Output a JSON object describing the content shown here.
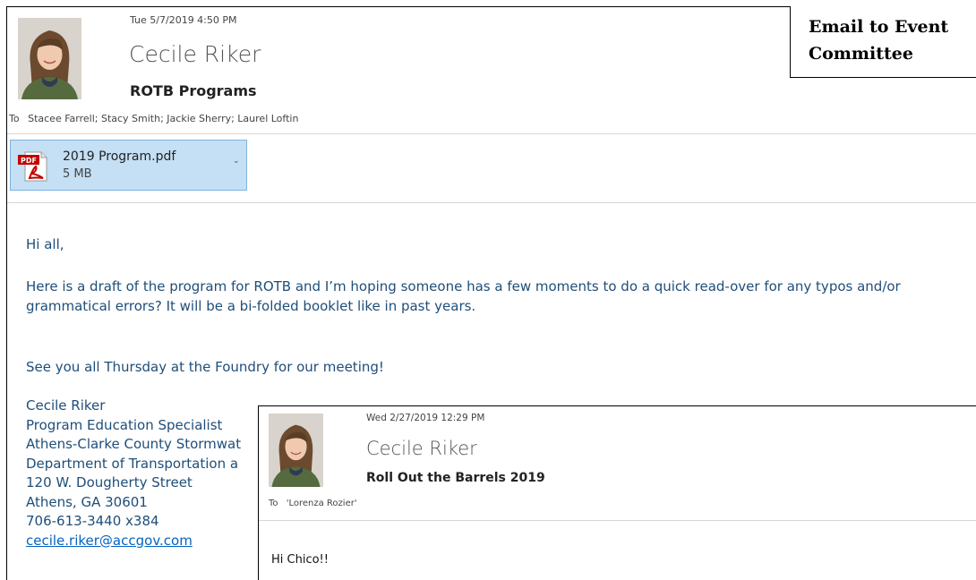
{
  "main_email": {
    "date": "Tue 5/7/2019 4:50 PM",
    "sender": "Cecile Riker",
    "subject": "ROTB Programs",
    "to_label": "To",
    "recipients": "Stacee Farrell; Stacy Smith; Jackie Sherry; Laurel Loftin",
    "attachment": {
      "icon": "pdf-file-icon",
      "icon_text": "PDF",
      "name": "2019 Program.pdf",
      "size": "5 MB",
      "chevron": "⌄"
    },
    "body": {
      "greeting": "Hi all,",
      "paragraph": "Here is a draft of the program for ROTB and I’m hoping someone has a few moments to do a quick read-over for any typos and/or grammatical errors? It will be a bi-folded booklet like in past years.",
      "closing": "See you all Thursday at the Foundry for our meeting!"
    },
    "signature": {
      "name": "Cecile Riker",
      "title": "Program Education Specialist",
      "org": "Athens-Clarke County Stormwat",
      "dept": "Department of Transportation a",
      "street": "120 W. Dougherty Street",
      "city": "Athens, GA 30601",
      "phone": "706-613-3440 x384",
      "email": "cecile.riker@accgov.com"
    }
  },
  "label_box": {
    "line1": "Email to Event",
    "line2": "Committee"
  },
  "inset_email": {
    "date": "Wed 2/27/2019 12:29 PM",
    "sender": "Cecile Riker",
    "subject": "Roll Out the Barrels 2019",
    "to_label": "To",
    "recipients": "'Lorenza Rozier'",
    "body_greeting": "Hi Chico!!"
  },
  "colors": {
    "body_text": "#1f4e79",
    "link": "#0563c1",
    "attachment_bg": "#c5dff4",
    "pdf_red": "#c00000"
  }
}
